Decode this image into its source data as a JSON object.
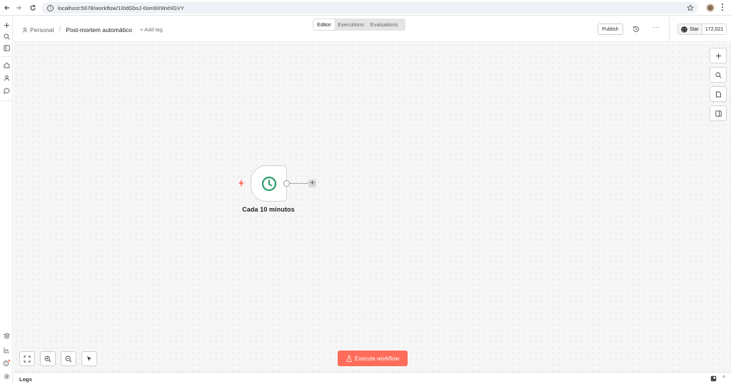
{
  "browser": {
    "url": "localhost:5678/workflow/1I0dGbsJ-0om9XWxhlGVY",
    "back_icon": "arrow-left-icon",
    "forward_icon": "arrow-right-icon",
    "reload_icon": "reload-icon"
  },
  "header": {
    "breadcrumb_personal": "Personal",
    "breadcrumb_sep": "/",
    "workflow_title": "Post-mortem automático",
    "add_tag": "+ Add tag",
    "publish_label": "Publish",
    "more_label": "···",
    "github_star_label": "Star",
    "github_star_count": "172,021"
  },
  "tabs": [
    {
      "label": "Editor",
      "active": true
    },
    {
      "label": "Executions",
      "active": false
    },
    {
      "label": "Evaluations",
      "active": false
    }
  ],
  "node": {
    "label": "Cada 10 minutos",
    "plus": "+"
  },
  "canvas": {
    "execute_label": "Execute workflow"
  },
  "logs": {
    "label": "Logs",
    "chevron": "^"
  },
  "colors": {
    "accent": "#ff6d5a",
    "node_icon": "#2a9d68",
    "trigger": "#ff6d5a"
  }
}
